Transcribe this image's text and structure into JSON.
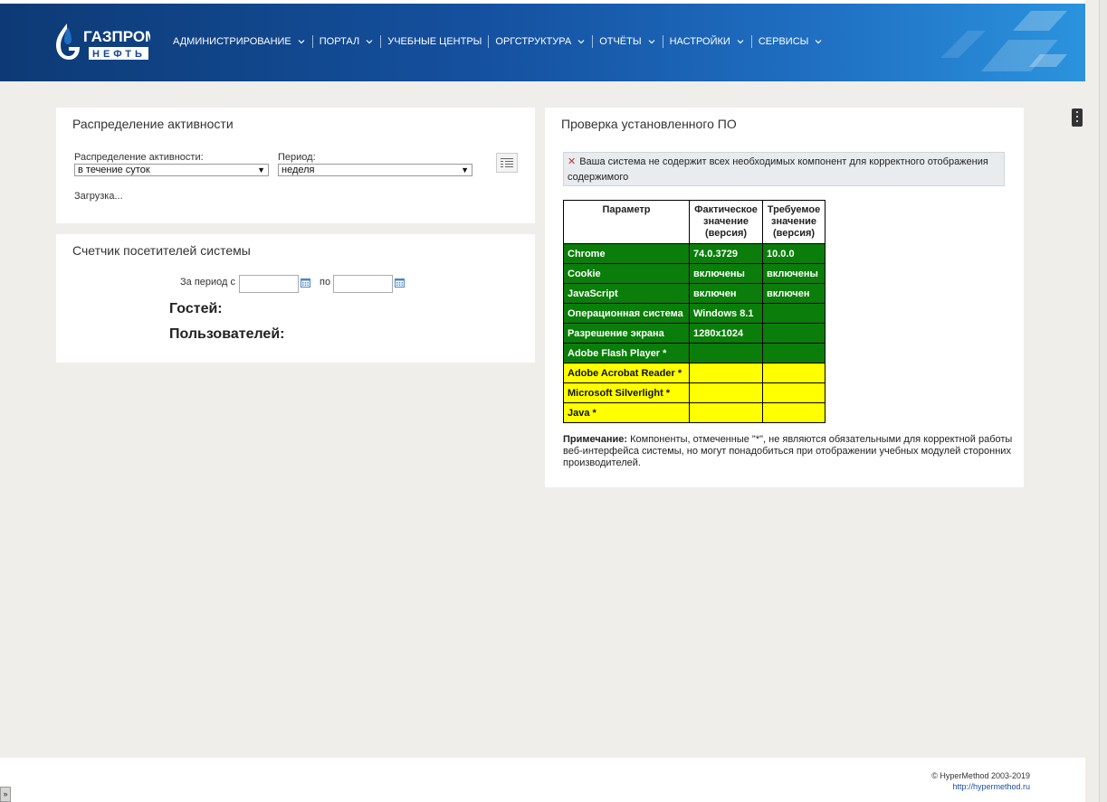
{
  "header": {
    "logo": {
      "line1": "ГАЗПРОМ",
      "line2": "НЕФТЬ"
    },
    "nav": [
      {
        "label": "АДМИНИСТРИРОВАНИЕ",
        "dropdown": true
      },
      {
        "label": "ПОРТАЛ",
        "dropdown": true
      },
      {
        "label": "УЧЕБНЫЕ ЦЕНТРЫ",
        "dropdown": false
      },
      {
        "label": "ОРГСТРУКТУРА",
        "dropdown": true
      },
      {
        "label": "ОТЧЁТЫ",
        "dropdown": true
      },
      {
        "label": "НАСТРОЙКИ",
        "dropdown": true
      },
      {
        "label": "СЕРВИСЫ",
        "dropdown": true
      }
    ]
  },
  "activity": {
    "title": "Распределение активности",
    "distribution_label": "Распределение активности:",
    "distribution_value": "в течение суток",
    "period_label": "Период:",
    "period_value": "неделя",
    "loading": "Загрузка..."
  },
  "counter": {
    "title": "Счетчик посетителей системы",
    "from_label": "За период с",
    "to_label": "по",
    "from_value": "",
    "to_value": "",
    "guests_label": "Гостей:",
    "users_label": "Пользователей:"
  },
  "check": {
    "title": "Проверка установленного ПО",
    "warning": "Ваша система не содержит всех необходимых компонент для корректного отображения содержимого",
    "columns": [
      "Параметр",
      "Фактическое значение (версия)",
      "Требуемое значение (версия)"
    ],
    "rows": [
      {
        "param": "Chrome",
        "actual": "74.0.3729",
        "required": "10.0.0",
        "status": "ok"
      },
      {
        "param": "Cookie",
        "actual": "включены",
        "required": "включены",
        "status": "ok"
      },
      {
        "param": "JavaScript",
        "actual": "включен",
        "required": "включен",
        "status": "ok"
      },
      {
        "param": "Операционная система",
        "actual": "Windows 8.1",
        "required": "",
        "status": "ok"
      },
      {
        "param": "Разрешение экрана",
        "actual": "1280x1024",
        "required": "",
        "status": "ok"
      },
      {
        "param": "Adobe Flash Player *",
        "actual": "",
        "required": "",
        "status": "ok"
      },
      {
        "param": "Adobe Acrobat Reader *",
        "actual": "",
        "required": "",
        "status": "warn"
      },
      {
        "param": "Microsoft Silverlight *",
        "actual": "",
        "required": "",
        "status": "warn"
      },
      {
        "param": "Java *",
        "actual": "",
        "required": "",
        "status": "warn"
      }
    ],
    "note_bold": "Примечание:",
    "note_text": " Компоненты, отмеченные \"*\", не являются обязательными для корректной работы веб-интерфейса системы, но могут понадобиться при отображении учебных модулей сторонних производителей."
  },
  "footer": {
    "copyright": "© HyperMethod 2003-2019",
    "link": "http://hypermethod.ru"
  },
  "colors": {
    "ok": "#0a7d0a",
    "warn": "#ffff00",
    "header": "#1551a0"
  }
}
